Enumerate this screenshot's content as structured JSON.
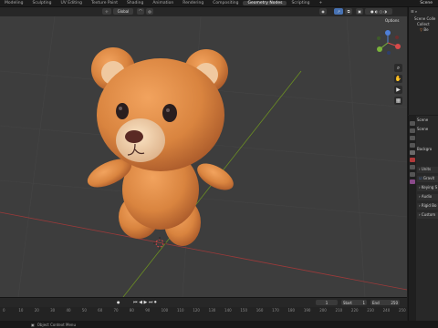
{
  "topbar": {
    "tabs": [
      "Modeling",
      "Sculpting",
      "UV Editing",
      "Texture Paint",
      "Shading",
      "Animation",
      "Rendering",
      "Compositing",
      "Geometry Nodes",
      "Scripting",
      "+"
    ],
    "active_tab": "Geometry Nodes",
    "scene_label": "Scene"
  },
  "viewport_header": {
    "transform_orientation": "Global",
    "options_label": "Options"
  },
  "outliner": {
    "items": [
      "Scene Colle",
      "Collect",
      "Be"
    ]
  },
  "properties": {
    "header": "Scene",
    "scene_label": "Scene",
    "background_label": "Backgro",
    "sections": [
      "Units",
      "Gravit",
      "Keying S",
      "Audio",
      "Rigid Bo",
      "Custom"
    ]
  },
  "timeline": {
    "current_frame": "1",
    "start_label": "Start",
    "start_value": "1",
    "end_label": "End",
    "end_value": "250",
    "ruler_ticks": [
      "0",
      "10",
      "20",
      "30",
      "40",
      "50",
      "60",
      "70",
      "80",
      "90",
      "100",
      "110",
      "120",
      "130",
      "140",
      "150",
      "160",
      "170",
      "180",
      "190",
      "200",
      "210",
      "220",
      "230",
      "240",
      "250"
    ]
  },
  "statusbar": {
    "hint": "Object Context Menu"
  },
  "colors": {
    "viewport_bg": "#3d3d3d",
    "bear_body": "#d9843f",
    "bear_muzzle": "#f0cfa6",
    "x_axis": "#9c3a3a",
    "y_axis": "#6b8e23"
  }
}
